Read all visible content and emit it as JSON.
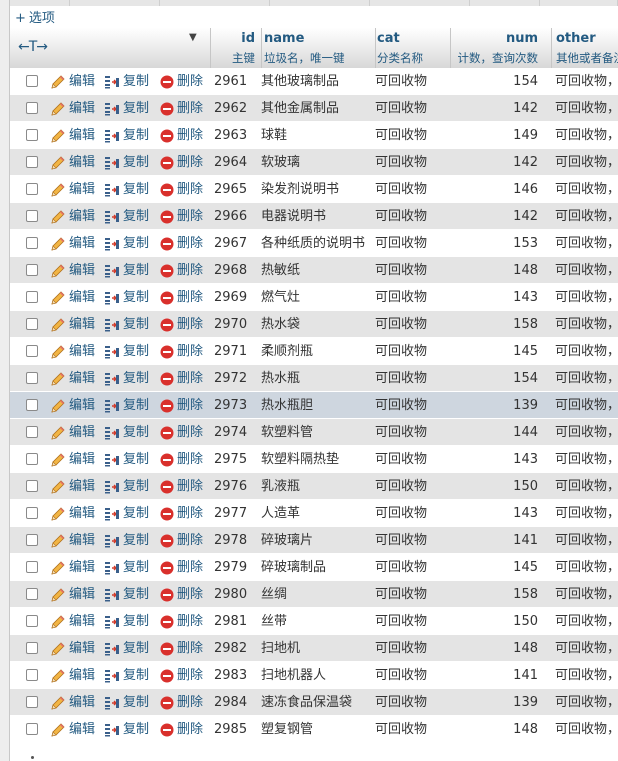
{
  "options_label": "选项",
  "options_plus": "+",
  "header": {
    "resize_glyph": "←T→",
    "sort_glyph": "▼",
    "columns": [
      {
        "key": "id",
        "title": "id",
        "sub": "主键"
      },
      {
        "key": "name",
        "title": "name",
        "sub": "垃圾名，唯一键"
      },
      {
        "key": "cat",
        "title": "cat",
        "sub": "分类名称"
      },
      {
        "key": "num",
        "title": "num",
        "sub": "计数，查询次数"
      },
      {
        "key": "other",
        "title": "other",
        "sub": "其他或者备注"
      }
    ]
  },
  "actions": {
    "edit": "编辑",
    "copy": "复制",
    "delete": "删除"
  },
  "rows": [
    {
      "id": "2961",
      "name": "其他玻璃制品",
      "cat": "可回收物",
      "num": "154",
      "other": "可回收物，"
    },
    {
      "id": "2962",
      "name": "其他金属制品",
      "cat": "可回收物",
      "num": "142",
      "other": "可回收物，"
    },
    {
      "id": "2963",
      "name": "球鞋",
      "cat": "可回收物",
      "num": "149",
      "other": "可回收物，"
    },
    {
      "id": "2964",
      "name": "软玻璃",
      "cat": "可回收物",
      "num": "142",
      "other": "可回收物，"
    },
    {
      "id": "2965",
      "name": "染发剂说明书",
      "cat": "可回收物",
      "num": "146",
      "other": "可回收物，"
    },
    {
      "id": "2966",
      "name": "电器说明书",
      "cat": "可回收物",
      "num": "142",
      "other": "可回收物，"
    },
    {
      "id": "2967",
      "name": "各种纸质的说明书",
      "cat": "可回收物",
      "num": "153",
      "other": "可回收物，"
    },
    {
      "id": "2968",
      "name": "热敏纸",
      "cat": "可回收物",
      "num": "148",
      "other": "可回收物，"
    },
    {
      "id": "2969",
      "name": "燃气灶",
      "cat": "可回收物",
      "num": "143",
      "other": "可回收物，"
    },
    {
      "id": "2970",
      "name": "热水袋",
      "cat": "可回收物",
      "num": "158",
      "other": "可回收物，"
    },
    {
      "id": "2971",
      "name": "柔顺剂瓶",
      "cat": "可回收物",
      "num": "145",
      "other": "可回收物，"
    },
    {
      "id": "2972",
      "name": "热水瓶",
      "cat": "可回收物",
      "num": "154",
      "other": "可回收物，"
    },
    {
      "id": "2973",
      "name": "热水瓶胆",
      "cat": "可回收物",
      "num": "139",
      "other": "可回收物，"
    },
    {
      "id": "2974",
      "name": "软塑料管",
      "cat": "可回收物",
      "num": "144",
      "other": "可回收物，"
    },
    {
      "id": "2975",
      "name": "软塑料隔热垫",
      "cat": "可回收物",
      "num": "143",
      "other": "可回收物，"
    },
    {
      "id": "2976",
      "name": "乳液瓶",
      "cat": "可回收物",
      "num": "150",
      "other": "可回收物，"
    },
    {
      "id": "2977",
      "name": "人造革",
      "cat": "可回收物",
      "num": "143",
      "other": "可回收物，"
    },
    {
      "id": "2978",
      "name": "碎玻璃片",
      "cat": "可回收物",
      "num": "141",
      "other": "可回收物，"
    },
    {
      "id": "2979",
      "name": "碎玻璃制品",
      "cat": "可回收物",
      "num": "145",
      "other": "可回收物，"
    },
    {
      "id": "2980",
      "name": "丝绸",
      "cat": "可回收物",
      "num": "158",
      "other": "可回收物，"
    },
    {
      "id": "2981",
      "name": "丝带",
      "cat": "可回收物",
      "num": "150",
      "other": "可回收物，"
    },
    {
      "id": "2982",
      "name": "扫地机",
      "cat": "可回收物",
      "num": "148",
      "other": "可回收物，"
    },
    {
      "id": "2983",
      "name": "扫地机器人",
      "cat": "可回收物",
      "num": "141",
      "other": "可回收物，"
    },
    {
      "id": "2984",
      "name": "速冻食品保温袋",
      "cat": "可回收物",
      "num": "139",
      "other": "可回收物，"
    },
    {
      "id": "2985",
      "name": "塑复钢管",
      "cat": "可回收物",
      "num": "148",
      "other": "可回收物，"
    }
  ],
  "hovered_row_index": 12,
  "colors": {
    "link": "#235a81",
    "row_even": "#e4e4e4",
    "row_hover": "#ced6df",
    "delete_icon": "#d9302c",
    "pencil": "#e8a33a"
  },
  "icons": {
    "edit": "pencil-icon",
    "copy": "copy-icon",
    "delete": "delete-icon"
  }
}
